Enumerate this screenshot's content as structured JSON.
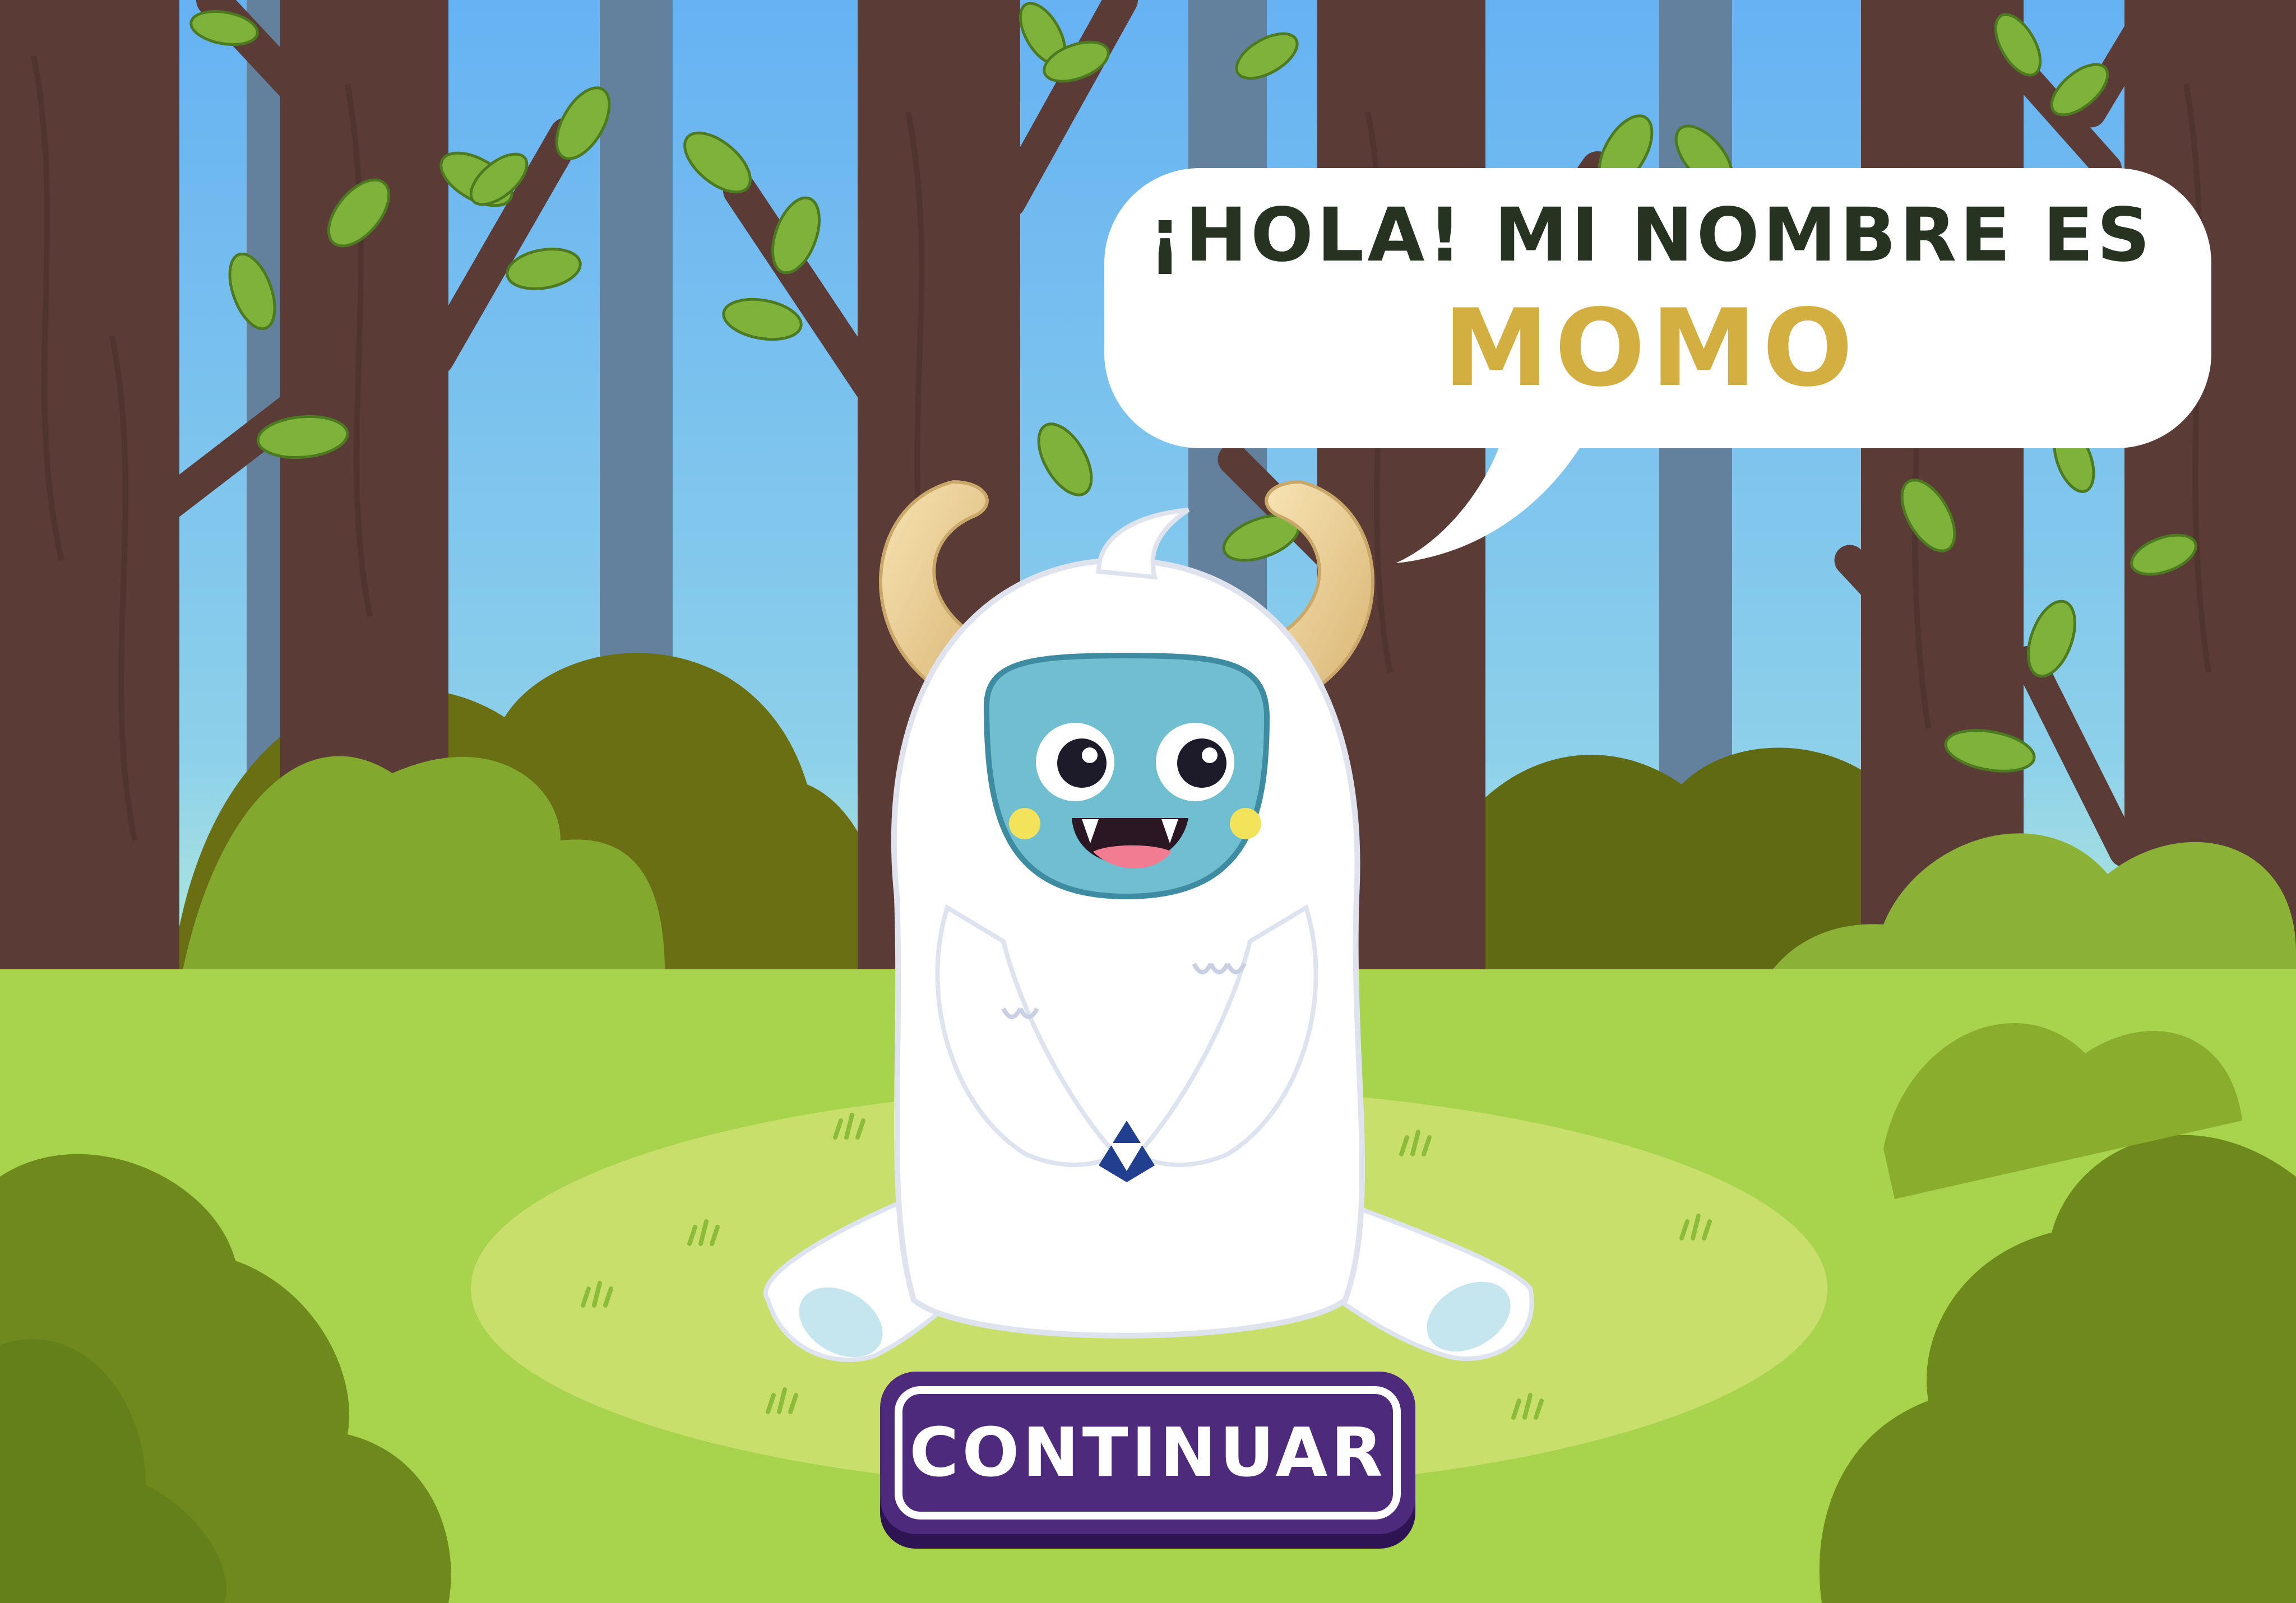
{
  "dialog": {
    "line1": "¡HOLA! MI NOMBRE ES",
    "line2": "MOMO"
  },
  "continue_button": {
    "label": "CONTINUAR"
  },
  "character": {
    "icon": "yeti-monster"
  },
  "colors": {
    "sky_top": "#67b3f2",
    "sky_bottom": "#b6eedd",
    "grass": "#a8d34c",
    "trunk": "#5a3b35",
    "name_highlight": "#d3ae40",
    "button": "#4e2a7d"
  }
}
